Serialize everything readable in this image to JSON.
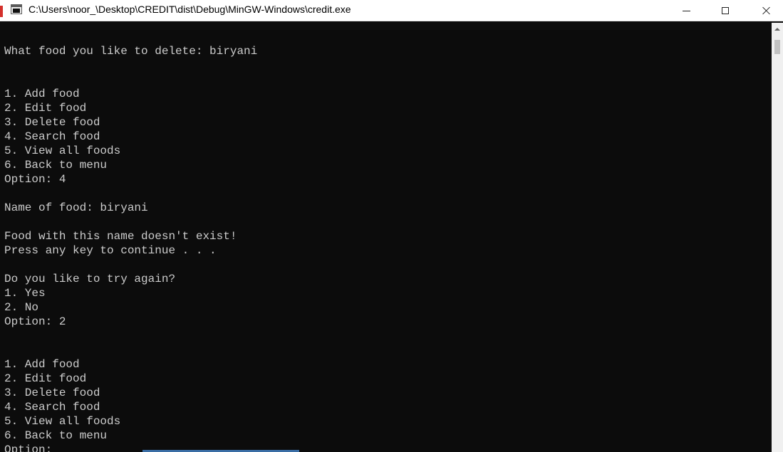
{
  "window": {
    "title": "C:\\Users\\noor_\\Desktop\\CREDIT\\dist\\Debug\\MinGW-Windows\\credit.exe"
  },
  "console": {
    "lines": [
      "",
      "What food you like to delete: biryani",
      "",
      "",
      "1. Add food",
      "2. Edit food",
      "3. Delete food",
      "4. Search food",
      "5. View all foods",
      "6. Back to menu",
      "Option: 4",
      "",
      "Name of food: biryani",
      "",
      "Food with this name doesn't exist!",
      "Press any key to continue . . .",
      "",
      "Do you like to try again?",
      "1. Yes",
      "2. No",
      "Option: 2",
      "",
      "",
      "1. Add food",
      "2. Edit food",
      "3. Delete food",
      "4. Search food",
      "5. View all foods",
      "6. Back to menu",
      "Option: "
    ]
  },
  "colors": {
    "console_bg": "#0c0c0c",
    "console_fg": "#cccccc",
    "titlebar_bg": "#ffffff"
  },
  "icons": {
    "app": "console-window-icon",
    "minimize": "minimize-icon",
    "maximize": "maximize-icon",
    "close": "close-icon"
  }
}
